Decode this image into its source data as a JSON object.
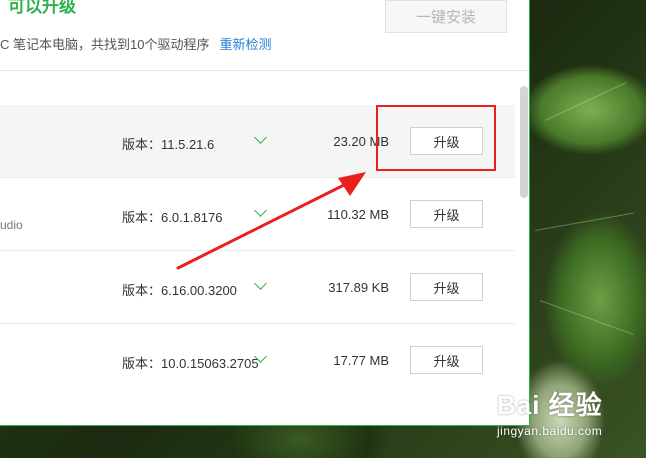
{
  "header": {
    "title": "可以升级",
    "subtitle": "C 笔记本电脑，共找到10个驱动程序",
    "rescan_label": "重新检测",
    "one_click_label": "一键安装"
  },
  "drivers": [
    {
      "sub": "",
      "version": "版本：11.5.21.6",
      "size": "23.20 MB",
      "action": "升级"
    },
    {
      "sub": "udio",
      "version": "版本：6.0.1.8176",
      "size": "110.32 MB",
      "action": "升级"
    },
    {
      "sub": "",
      "version": "版本：6.16.00.3200",
      "size": "317.89 KB",
      "action": "升级"
    },
    {
      "sub": "",
      "version": "版本：10.0.15063.2705",
      "size": "17.77 MB",
      "action": "升级"
    }
  ],
  "watermark": {
    "logo": "Bai 经验",
    "url": "jingyan.baidu.com"
  },
  "colors": {
    "accent": "#2bb24c",
    "link": "#1f7fd8",
    "annotation": "#e8211e"
  }
}
